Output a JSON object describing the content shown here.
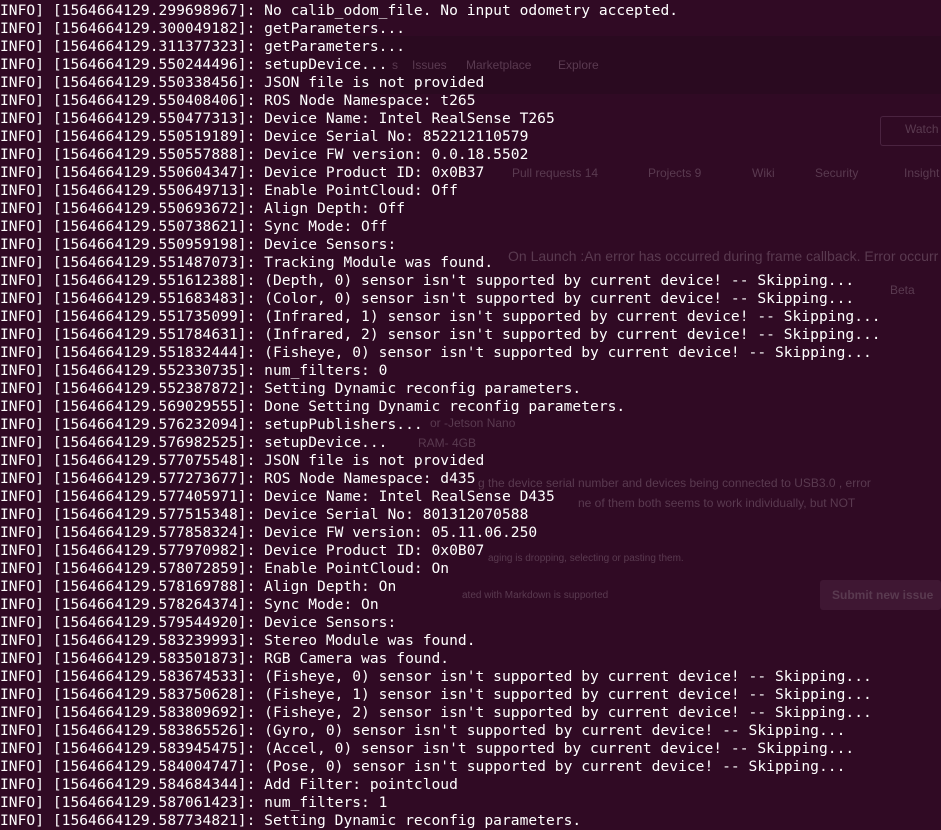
{
  "background_window": {
    "nav": [
      "s",
      "Issues",
      "Marketplace",
      "Explore"
    ],
    "tabs": [
      "Pull requests 14",
      "Projects 9",
      "Wiki",
      "Security",
      "Insight"
    ],
    "watch": "Watch",
    "issue_title": "On Launch :An error has occurred during frame callback. Error occurr",
    "badge": "Beta",
    "device_text": "or -Jetson Nano",
    "ram_text": "RAM- 4GB",
    "body_line1": "g the device serial number and devices being connected to USB3.0 , error",
    "body_line2": "ne of them both seems to work individually, but NOT",
    "attach_text": "aging is dropping, selecting or pasting them.",
    "markdown_text": "ated with Markdown is supported",
    "submit_label": "Submit new issue"
  },
  "terminal": {
    "lines": [
      "INFO] [1564664129.299698967]: No calib_odom_file. No input odometry accepted.",
      "INFO] [1564664129.300049182]: getParameters...",
      "INFO] [1564664129.311377323]: getParameters...",
      "INFO] [1564664129.550244496]: setupDevice...",
      "INFO] [1564664129.550338456]: JSON file is not provided",
      "INFO] [1564664129.550408406]: ROS Node Namespace: t265",
      "INFO] [1564664129.550477313]: Device Name: Intel RealSense T265",
      "INFO] [1564664129.550519189]: Device Serial No: 852212110579",
      "INFO] [1564664129.550557888]: Device FW version: 0.0.18.5502",
      "INFO] [1564664129.550604347]: Device Product ID: 0x0B37",
      "INFO] [1564664129.550649713]: Enable PointCloud: Off",
      "INFO] [1564664129.550693672]: Align Depth: Off",
      "INFO] [1564664129.550738621]: Sync Mode: Off",
      "INFO] [1564664129.550959198]: Device Sensors:",
      "INFO] [1564664129.551487073]: Tracking Module was found.",
      "INFO] [1564664129.551612388]: (Depth, 0) sensor isn't supported by current device! -- Skipping...",
      "INFO] [1564664129.551683483]: (Color, 0) sensor isn't supported by current device! -- Skipping...",
      "INFO] [1564664129.551735099]: (Infrared, 1) sensor isn't supported by current device! -- Skipping...",
      "INFO] [1564664129.551784631]: (Infrared, 2) sensor isn't supported by current device! -- Skipping...",
      "INFO] [1564664129.551832444]: (Fisheye, 0) sensor isn't supported by current device! -- Skipping...",
      "INFO] [1564664129.552330735]: num_filters: 0",
      "INFO] [1564664129.552387872]: Setting Dynamic reconfig parameters.",
      "INFO] [1564664129.569029555]: Done Setting Dynamic reconfig parameters.",
      "INFO] [1564664129.576232094]: setupPublishers...",
      "INFO] [1564664129.576982525]: setupDevice...",
      "INFO] [1564664129.577075548]: JSON file is not provided",
      "INFO] [1564664129.577273677]: ROS Node Namespace: d435",
      "INFO] [1564664129.577405971]: Device Name: Intel RealSense D435",
      "INFO] [1564664129.577515348]: Device Serial No: 801312070588",
      "INFO] [1564664129.577858324]: Device FW version: 05.11.06.250",
      "INFO] [1564664129.577970982]: Device Product ID: 0x0B07",
      "INFO] [1564664129.578072859]: Enable PointCloud: On",
      "INFO] [1564664129.578169788]: Align Depth: On",
      "INFO] [1564664129.578264374]: Sync Mode: On",
      "INFO] [1564664129.579544920]: Device Sensors:",
      "INFO] [1564664129.583239993]: Stereo Module was found.",
      "INFO] [1564664129.583501873]: RGB Camera was found.",
      "INFO] [1564664129.583674533]: (Fisheye, 0) sensor isn't supported by current device! -- Skipping...",
      "INFO] [1564664129.583750628]: (Fisheye, 1) sensor isn't supported by current device! -- Skipping...",
      "INFO] [1564664129.583809692]: (Fisheye, 2) sensor isn't supported by current device! -- Skipping...",
      "INFO] [1564664129.583865526]: (Gyro, 0) sensor isn't supported by current device! -- Skipping...",
      "INFO] [1564664129.583945475]: (Accel, 0) sensor isn't supported by current device! -- Skipping...",
      "INFO] [1564664129.584004747]: (Pose, 0) sensor isn't supported by current device! -- Skipping...",
      "INFO] [1564664129.584684344]: Add Filter: pointcloud",
      "INFO] [1564664129.587061423]: num_filters: 1",
      "INFO] [1564664129.587734821]: Setting Dynamic reconfig parameters."
    ]
  },
  "colors": {
    "terminal_bg": "#300a24",
    "text": "#ffffff"
  }
}
